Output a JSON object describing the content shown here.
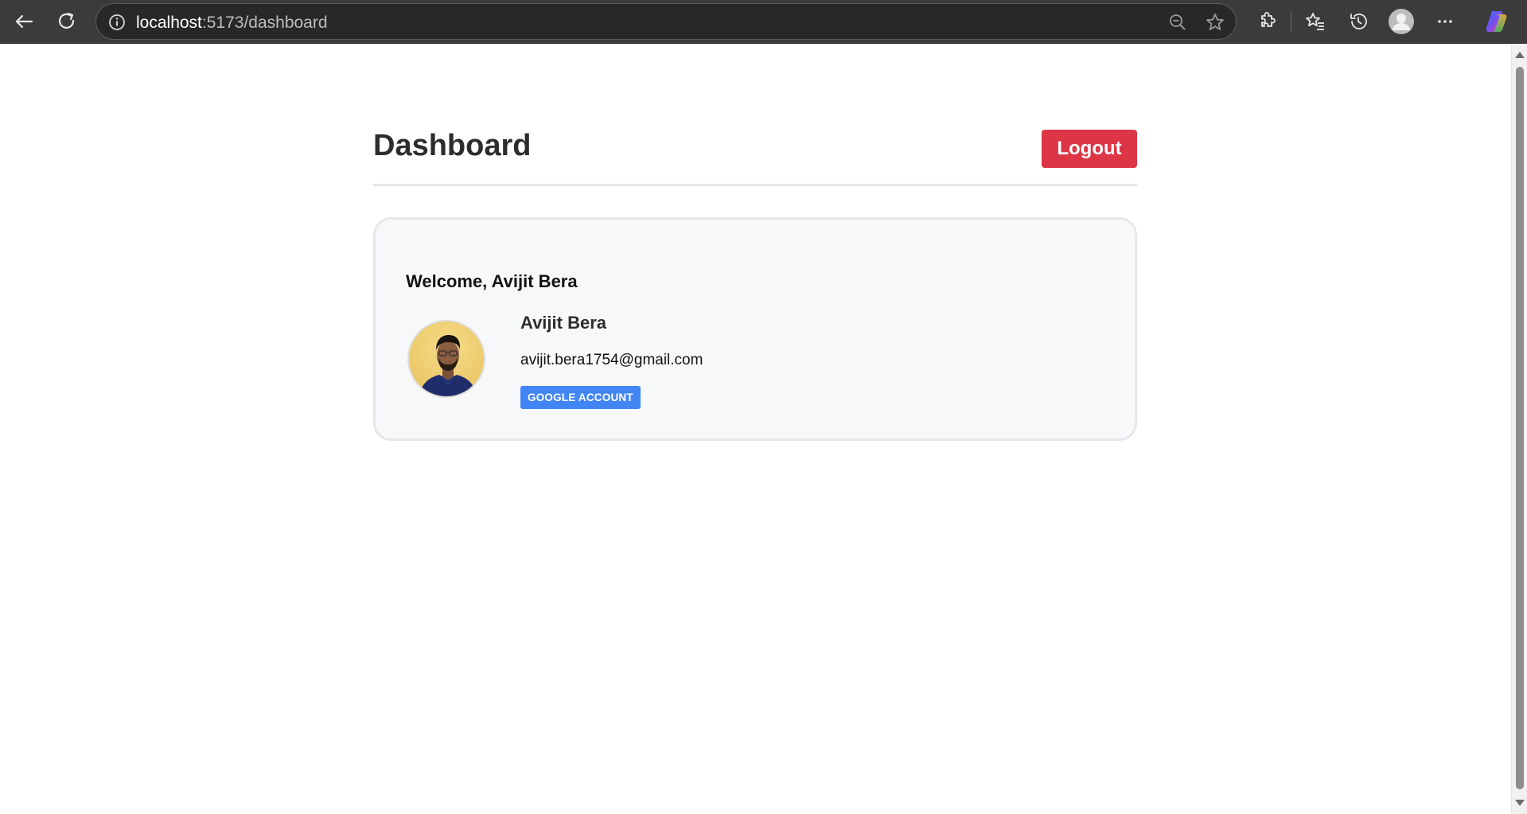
{
  "browser": {
    "url_host": "localhost",
    "url_path": ":5173/dashboard"
  },
  "icons": {
    "back": "back-arrow-icon",
    "refresh": "refresh-icon",
    "site_info": "info-icon",
    "zoom": "zoom-out-icon",
    "favorite": "star-icon",
    "extensions": "puzzle-icon",
    "favorites_list": "favorites-icon",
    "history": "history-icon",
    "profile": "profile-icon",
    "more": "more-icon",
    "copilot": "copilot-icon"
  },
  "dashboard": {
    "title": "Dashboard",
    "logout_label": "Logout"
  },
  "profile": {
    "welcome": "Welcome, Avijit Bera",
    "name": "Avijit Bera",
    "email": "avijit.bera1754@gmail.com",
    "account_type": "GOOGLE ACCOUNT"
  },
  "colors": {
    "logout": "#dc3545",
    "badge": "#4285f4",
    "card_background": "#f7f8fa"
  }
}
